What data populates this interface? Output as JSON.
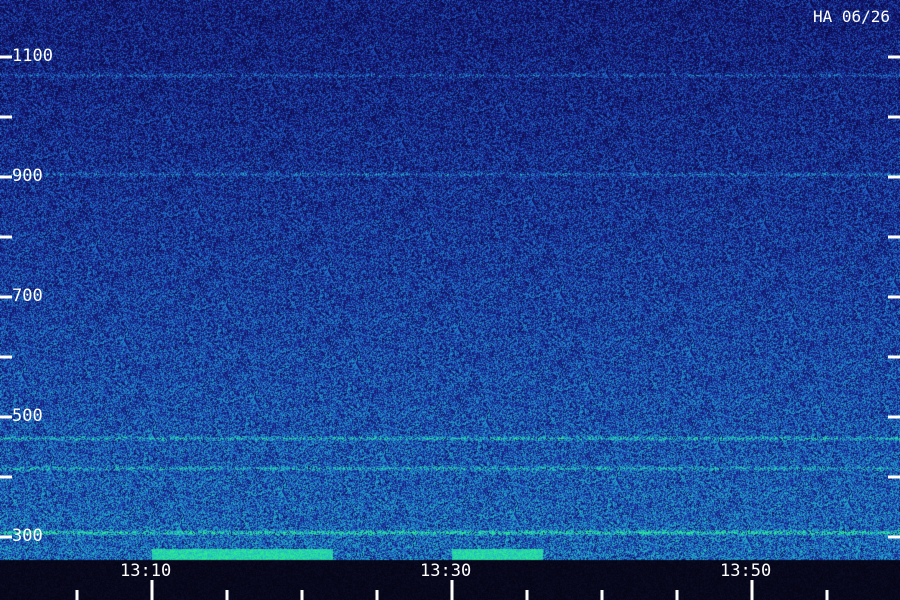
{
  "station_label": "HA 06/26",
  "chart_data": {
    "type": "heatmap",
    "title": "",
    "xlabel": "",
    "ylabel": "",
    "y_tick_labels": [
      "1100",
      "900",
      "700",
      "500",
      "300"
    ],
    "y_ticks": [
      1100,
      1000,
      900,
      800,
      700,
      600,
      500,
      400,
      300
    ],
    "ylim": [
      280,
      1180
    ],
    "x_tick_labels": [
      "13:10",
      "13:30",
      "13:50"
    ],
    "x_major_ticks": [
      "13:10",
      "13:30",
      "13:50"
    ],
    "x_minor_ticks": [
      "13:05",
      "13:15",
      "13:20",
      "13:25",
      "13:35",
      "13:40",
      "13:45",
      "13:55"
    ],
    "xlim": [
      "13:00",
      "14:00"
    ],
    "grid": false,
    "colors": {
      "background": "#0b0a4a",
      "low": "#1a2590",
      "mid": "#1f6cc8",
      "high": "#22c0c0",
      "peak": "#2ef08a",
      "axis": "#ffffff"
    },
    "bright_bands": [
      {
        "y": 1070,
        "level": 0.35
      },
      {
        "y": 905,
        "level": 0.35
      },
      {
        "y": 465,
        "level": 0.55
      },
      {
        "y": 415,
        "level": 0.45
      },
      {
        "y": 308,
        "level": 0.8
      }
    ],
    "bottom_burst_segments": [
      {
        "start": "13:10",
        "end": "13:22"
      },
      {
        "start": "13:30",
        "end": "13:36"
      }
    ]
  }
}
